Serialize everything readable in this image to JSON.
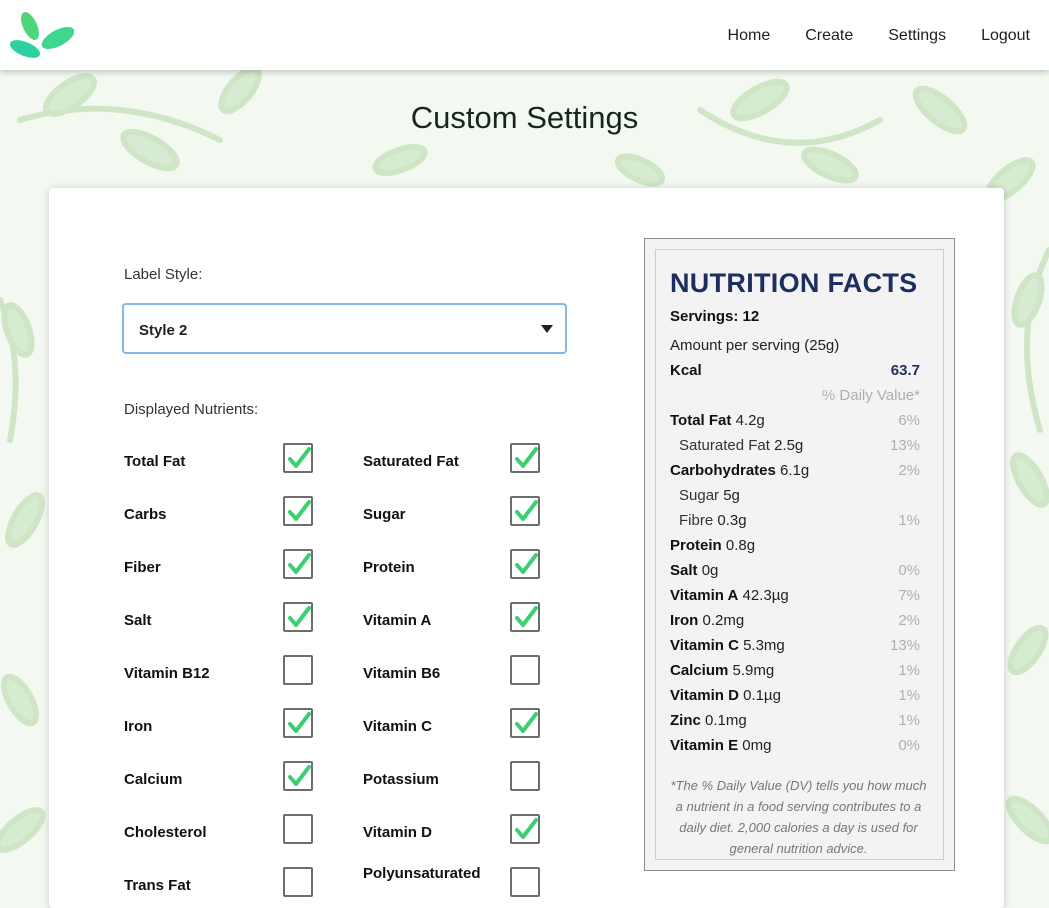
{
  "nav": {
    "links": [
      "Home",
      "Create",
      "Settings",
      "Logout"
    ]
  },
  "page_title": "Custom Settings",
  "label_style": {
    "label": "Label Style:",
    "selected": "Style 2"
  },
  "nutrients_label": "Displayed Nutrients:",
  "nutrients": [
    {
      "name": "Total Fat",
      "checked": true
    },
    {
      "name": "Saturated Fat",
      "checked": true
    },
    {
      "name": "Carbs",
      "checked": true
    },
    {
      "name": "Sugar",
      "checked": true
    },
    {
      "name": "Fiber",
      "checked": true
    },
    {
      "name": "Protein",
      "checked": true
    },
    {
      "name": "Salt",
      "checked": true
    },
    {
      "name": "Vitamin A",
      "checked": true
    },
    {
      "name": "Vitamin B12",
      "checked": false
    },
    {
      "name": "Vitamin B6",
      "checked": false
    },
    {
      "name": "Iron",
      "checked": true
    },
    {
      "name": "Vitamin C",
      "checked": true
    },
    {
      "name": "Calcium",
      "checked": true
    },
    {
      "name": "Potassium",
      "checked": false
    },
    {
      "name": "Cholesterol",
      "checked": false
    },
    {
      "name": "Vitamin D",
      "checked": true
    },
    {
      "name": "Trans Fat",
      "checked": false
    },
    {
      "name": "Polyunsaturated",
      "checked": false
    }
  ],
  "nutrition_facts": {
    "title": "NUTRITION FACTS",
    "servings": "Servings: 12",
    "amount": "Amount per serving (25g)",
    "kcal_label": "Kcal",
    "kcal_value": "63.7",
    "dv_header": "% Daily Value*",
    "rows": [
      {
        "name": "Total Fat",
        "value": "4.2g",
        "pct": "6%",
        "sub": false
      },
      {
        "name": "Saturated Fat",
        "value": "2.5g",
        "pct": "13%",
        "sub": true
      },
      {
        "name": "Carbohydrates",
        "value": "6.1g",
        "pct": "2%",
        "sub": false
      },
      {
        "name": "Sugar",
        "value": "5g",
        "pct": "",
        "sub": true
      },
      {
        "name": "Fibre",
        "value": "0.3g",
        "pct": "1%",
        "sub": true
      },
      {
        "name": "Protein",
        "value": "0.8g",
        "pct": "",
        "sub": false
      },
      {
        "name": "Salt",
        "value": "0g",
        "pct": "0%",
        "sub": false
      },
      {
        "name": "Vitamin A",
        "value": "42.3µg",
        "pct": "7%",
        "sub": false
      },
      {
        "name": "Iron",
        "value": "0.2mg",
        "pct": "2%",
        "sub": false
      },
      {
        "name": "Vitamin C",
        "value": "5.3mg",
        "pct": "13%",
        "sub": false
      },
      {
        "name": "Calcium",
        "value": "5.9mg",
        "pct": "1%",
        "sub": false
      },
      {
        "name": "Vitamin D",
        "value": "0.1µg",
        "pct": "1%",
        "sub": false
      },
      {
        "name": "Zinc",
        "value": "0.1mg",
        "pct": "1%",
        "sub": false
      },
      {
        "name": "Vitamin E",
        "value": "0mg",
        "pct": "0%",
        "sub": false
      }
    ],
    "footnote": "*The % Daily Value (DV) tells you how much a nutrient in a food serving contributes to a daily diet. 2,000 calories a day is used for general nutrition advice."
  },
  "colors": {
    "brand_primary": "#2dd1a0",
    "brand_secondary": "#4fd67a",
    "check_green": "#3ccf72",
    "facts_title": "#1d2f5e",
    "select_border": "#86b7e4"
  },
  "icons": {
    "logo": "leaf-logo-icon",
    "checkbox_check": "check-icon",
    "select_caret": "caret-down-icon"
  }
}
